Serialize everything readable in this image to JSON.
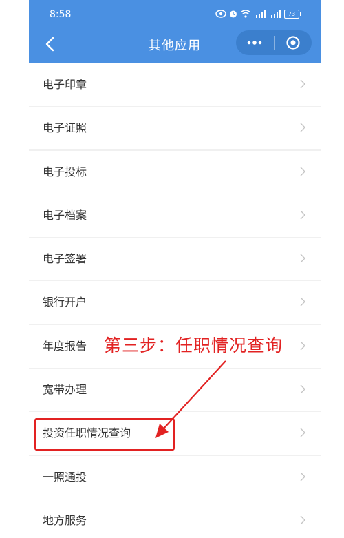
{
  "status_bar": {
    "time": "8:58",
    "battery": "73"
  },
  "header": {
    "title": "其他应用",
    "back_icon": "chevron-left-icon",
    "more_icon": "more-dots-icon",
    "close_icon": "record-circle-icon"
  },
  "menu": {
    "items": [
      {
        "label": "电子印章"
      },
      {
        "label": "电子证照"
      },
      {
        "label": "电子投标"
      },
      {
        "label": "电子档案"
      },
      {
        "label": "电子签署"
      },
      {
        "label": "银行开户"
      },
      {
        "label": "年度报告"
      },
      {
        "label": "宽带办理"
      },
      {
        "label": "投资任职情况查询"
      },
      {
        "label": "一照通投"
      },
      {
        "label": "地方服务"
      }
    ]
  },
  "annotation": {
    "text": "第三步：任职情况查询",
    "color": "#e22222"
  },
  "colors": {
    "header": "#4a90e2",
    "capsule": "#3b7fcd",
    "annotation": "#e22222"
  }
}
